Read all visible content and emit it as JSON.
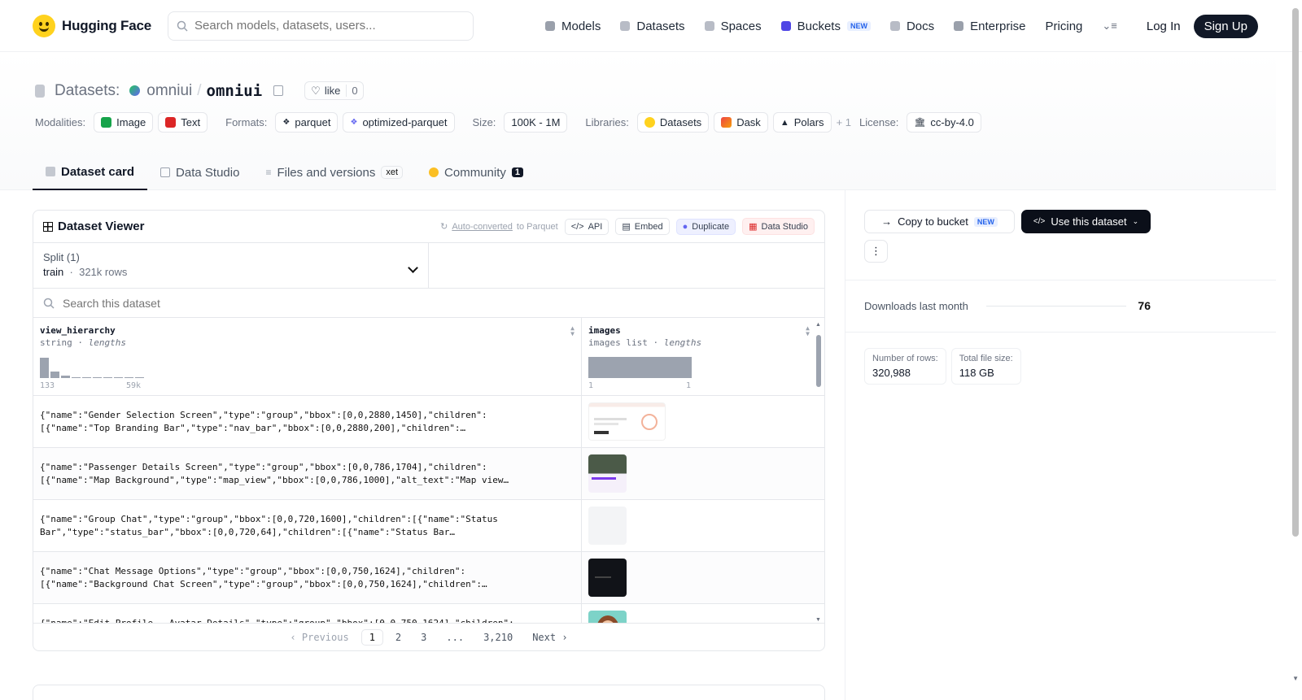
{
  "nav": {
    "brand": "Hugging Face",
    "search_placeholder": "Search models, datasets, users...",
    "links": [
      {
        "label": "Models",
        "color": "#9aa0ab"
      },
      {
        "label": "Datasets",
        "color": "#b8bcc6"
      },
      {
        "label": "Spaces",
        "color": "#b8bcc6"
      },
      {
        "label": "Buckets",
        "color": "#4f46e5"
      },
      {
        "label": "Docs",
        "color": "#b8bcc6"
      },
      {
        "label": "Enterprise",
        "color": "#9aa0ab"
      },
      {
        "label": "Pricing",
        "color": ""
      }
    ],
    "buckets_badge": "NEW",
    "login": "Log In",
    "signup": "Sign Up"
  },
  "repo": {
    "type_label": "Datasets:",
    "org": "omniui",
    "separator": "/",
    "name": "omniui",
    "like_label": "like",
    "like_count": "0"
  },
  "meta": {
    "modalities_label": "Modalities:",
    "modalities": [
      "Image",
      "Text"
    ],
    "formats_label": "Formats:",
    "formats": [
      "parquet",
      "optimized-parquet"
    ],
    "size_label": "Size:",
    "size": "100K - 1M",
    "libraries_label": "Libraries:",
    "libraries": [
      "Datasets",
      "Dask",
      "Polars"
    ],
    "libraries_more": "+ 1",
    "license_label": "License:",
    "license": "cc-by-4.0"
  },
  "tabs": [
    {
      "label": "Dataset card",
      "active": true
    },
    {
      "label": "Data Studio"
    },
    {
      "label": "Files and versions",
      "badge": "xet"
    },
    {
      "label": "Community",
      "badge": "1"
    }
  ],
  "viewer": {
    "title": "Dataset Viewer",
    "auto_converted": "Auto-converted",
    "to_parquet": "to Parquet",
    "api": "API",
    "embed": "Embed",
    "duplicate": "Duplicate",
    "data_studio": "Data Studio",
    "split_label": "Split (1)",
    "split_name": "train",
    "split_rows": "321k rows",
    "search_placeholder": "Search this dataset",
    "columns": [
      {
        "name": "view_hierarchy",
        "type": "string",
        "stat": "lengths",
        "min": "133",
        "max": "59k",
        "hist": [
          0.95,
          0.3,
          0.1,
          0.05,
          0.05,
          0.05,
          0.05,
          0.05,
          0.05,
          0.05
        ]
      },
      {
        "name": "images",
        "type": "images list",
        "stat": "lengths",
        "min": "1",
        "max": "1"
      }
    ],
    "rows": [
      {
        "line1": "{\"name\":\"Gender Selection Screen\",\"type\":\"group\",\"bbox\":[0,0,2880,1450],\"children\":",
        "line2": "[{\"name\":\"Top Branding Bar\",\"type\":\"nav_bar\",\"bbox\":[0,0,2880,200],\"children\":…"
      },
      {
        "line1": "{\"name\":\"Passenger Details Screen\",\"type\":\"group\",\"bbox\":[0,0,786,1704],\"children\":",
        "line2": "[{\"name\":\"Map Background\",\"type\":\"map_view\",\"bbox\":[0,0,786,1000],\"alt_text\":\"Map view…"
      },
      {
        "line1": "{\"name\":\"Group Chat\",\"type\":\"group\",\"bbox\":[0,0,720,1600],\"children\":[{\"name\":\"Status",
        "line2": "Bar\",\"type\":\"status_bar\",\"bbox\":[0,0,720,64],\"children\":[{\"name\":\"Status Bar…"
      },
      {
        "line1": "{\"name\":\"Chat Message Options\",\"type\":\"group\",\"bbox\":[0,0,750,1624],\"children\":",
        "line2": "[{\"name\":\"Background Chat Screen\",\"type\":\"group\",\"bbox\":[0,0,750,1624],\"children\":…"
      },
      {
        "line1": "{\"name\":\"Edit Profile - Avatar Details\",\"type\":\"group\",\"bbox\":[0,0,750,1624],\"children\":",
        "line2": ""
      }
    ],
    "pager": {
      "prev": "Previous",
      "pages": [
        "1",
        "2",
        "3",
        "...",
        "3,210"
      ],
      "next": "Next"
    }
  },
  "sidebar": {
    "copy_to_bucket": "Copy to bucket",
    "copy_badge": "NEW",
    "use_dataset": "Use this dataset",
    "downloads_label": "Downloads last month",
    "downloads": "76",
    "rows_label": "Number of rows:",
    "rows_value": "320,988",
    "size_label": "Total file size:",
    "size_value": "118 GB"
  },
  "icons": {
    "search": "search-icon",
    "copy": "copy-icon",
    "heart": "heart-icon",
    "menu": "menu-icon",
    "chevron_down": "chevron-down-icon"
  }
}
